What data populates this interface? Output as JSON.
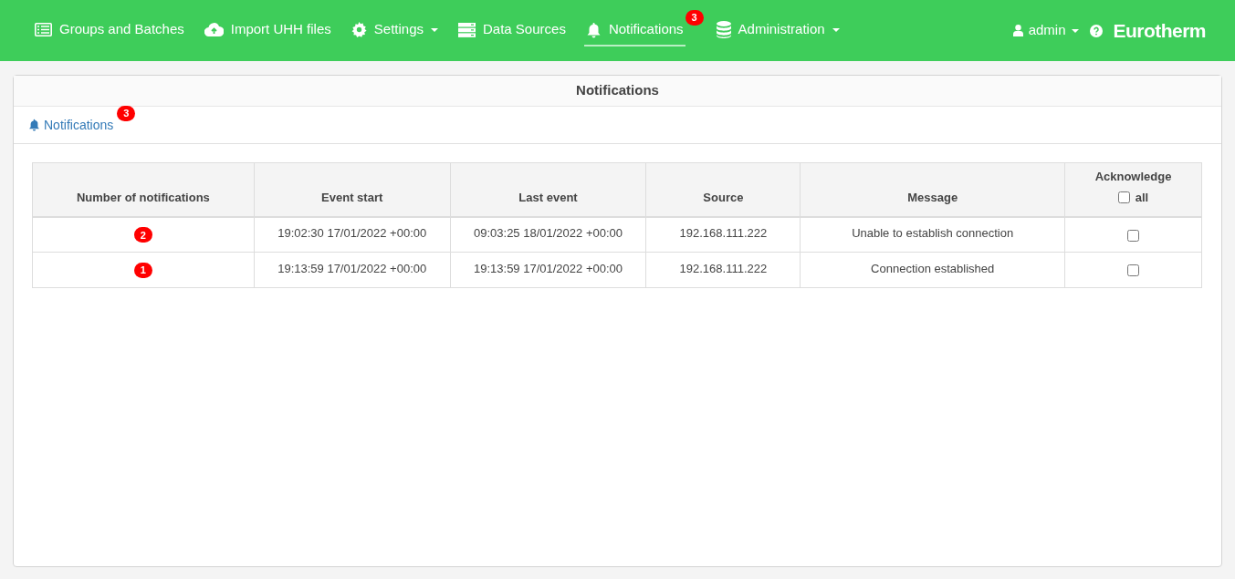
{
  "navbar": {
    "items": [
      {
        "label": "Groups and Batches",
        "dropdown": false,
        "selected": false
      },
      {
        "label": "Import UHH files",
        "dropdown": false,
        "selected": false
      },
      {
        "label": "Settings",
        "dropdown": true,
        "selected": false
      },
      {
        "label": "Data Sources",
        "dropdown": false,
        "selected": false
      },
      {
        "label": "Notifications",
        "dropdown": false,
        "selected": true,
        "badge": "3"
      },
      {
        "label": "Administration",
        "dropdown": true,
        "selected": false
      }
    ],
    "user": {
      "label": "admin",
      "dropdown": true
    },
    "logo": "Eurotherm"
  },
  "panel": {
    "title": "Notifications",
    "tab": {
      "label": "Notifications",
      "badge": "3"
    },
    "table": {
      "columns": [
        "Number of notifications",
        "Event start",
        "Last event",
        "Source",
        "Message",
        "Acknowledge"
      ],
      "acknowledge_all": {
        "label": "all",
        "checked": false
      },
      "rows": [
        {
          "count": "2",
          "event_start": "19:02:30 17/01/2022 +00:00",
          "last_event": "09:03:25 18/01/2022 +00:00",
          "source": "192.168.111.222",
          "message": "Unable to establish connection",
          "acknowledged": false
        },
        {
          "count": "1",
          "event_start": "19:13:59 17/01/2022 +00:00",
          "last_event": "19:13:59 17/01/2022 +00:00",
          "source": "192.168.111.222",
          "message": "Connection established",
          "acknowledged": false
        }
      ]
    }
  }
}
